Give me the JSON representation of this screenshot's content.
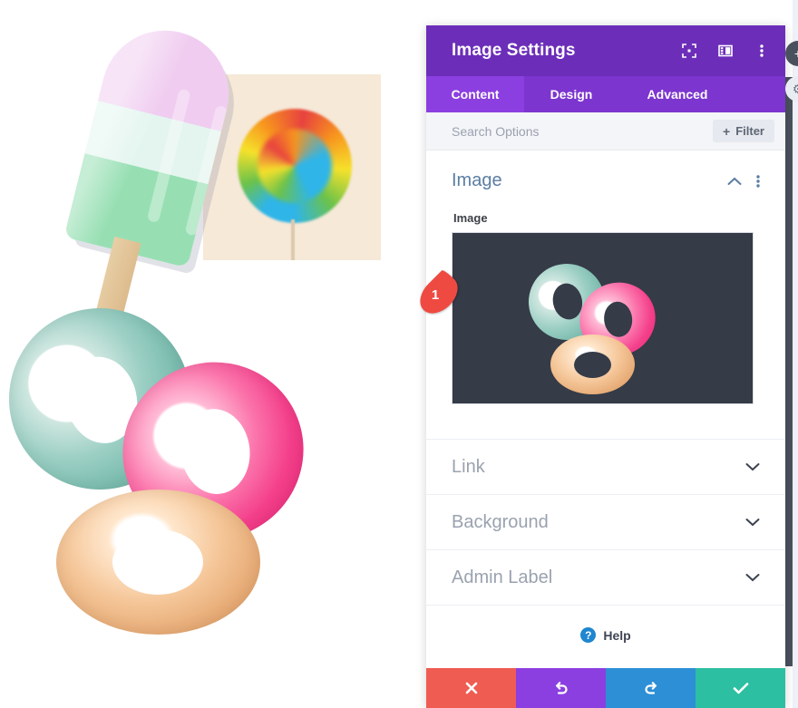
{
  "panel": {
    "header": {
      "title": "Image Settings",
      "icons": [
        {
          "name": "fullscreen-icon",
          "glyph": "⬚"
        },
        {
          "name": "layout-panel-icon",
          "glyph": "▥"
        },
        {
          "name": "kebab-menu-icon",
          "glyph": "⋮"
        }
      ]
    },
    "tabs": [
      {
        "label": "Content",
        "active": true
      },
      {
        "label": "Design",
        "active": false
      },
      {
        "label": "Advanced",
        "active": false
      }
    ],
    "search": {
      "placeholder": "Search Options",
      "value": "",
      "filter_label": "Filter",
      "filter_plus": "+"
    },
    "open_section": {
      "title": "Image",
      "collapse_icon": "chevron-up-icon",
      "kebab_icon": "kebab-menu-icon",
      "field_label": "Image",
      "preview_alt": "three donuts on dark background"
    },
    "collapsed_sections": [
      {
        "title": "Link",
        "chevron": "chevron-down-icon"
      },
      {
        "title": "Background",
        "chevron": "chevron-down-icon"
      },
      {
        "title": "Admin Label",
        "chevron": "chevron-down-icon"
      }
    ],
    "help": {
      "badge": "?",
      "label": "Help"
    },
    "actions": [
      {
        "name": "cancel-button",
        "glyph": "✕",
        "color": "#ef5c52"
      },
      {
        "name": "undo-button",
        "glyph": "↺",
        "color": "#8b3fe0"
      },
      {
        "name": "redo-button",
        "glyph": "↻",
        "color": "#2d8fd5"
      },
      {
        "name": "save-button",
        "glyph": "✔",
        "color": "#2dbfa2"
      }
    ],
    "edge_buttons": [
      {
        "name": "add-module-button",
        "glyph": "+"
      },
      {
        "name": "module-settings-button",
        "glyph": "⚙"
      }
    ]
  },
  "marker": {
    "number": "1"
  },
  "canvas": {
    "popsicle_alt": "pastel striped popsicle illustration",
    "lollipop_alt": "rainbow swirl lollipop photo",
    "donuts_alt": "mint pink and glazed donut illustration"
  },
  "colors": {
    "header_purple": "#6c2eb9",
    "tabs_purple": "#7c35cf",
    "tab_active_purple": "#8b3fe0",
    "section_title_blue": "#5b7da3",
    "preview_bg": "#353b47",
    "marker_red": "#ef4a42",
    "cancel_red": "#ef5c52",
    "undo_purple": "#8b3fe0",
    "redo_blue": "#2d8fd5",
    "save_teal": "#2dbfa2",
    "help_blue": "#1f86cf"
  }
}
